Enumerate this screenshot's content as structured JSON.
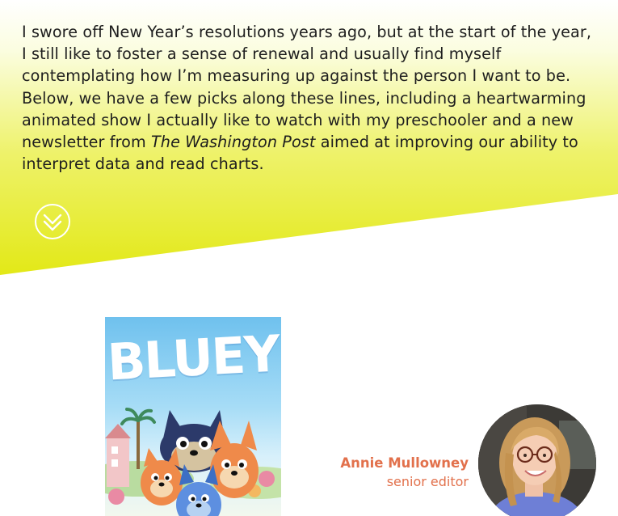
{
  "intro": {
    "text_before": "I swore off New Year’s resolutions years ago, but at the start of the year, I still like to foster a sense of renewal and usually find myself contemplating how I’m measuring up against the person I want to be. Below, we have a few picks along these lines, including a heartwarming animated show I actually like to watch with my preschooler and a new newsletter from ",
    "publication": "The Washington Post",
    "text_after": " aimed at improving our ability to interpret data and read charts."
  },
  "scroll_button": {
    "icon": "double-chevron-down-icon"
  },
  "poster": {
    "title": "BLUEY"
  },
  "editor": {
    "name": "Annie Mullowney",
    "role": "senior editor"
  },
  "colors": {
    "hero_yellow": "#e2e814",
    "accent_orange": "#e2714c",
    "text": "#1e1e1e"
  }
}
